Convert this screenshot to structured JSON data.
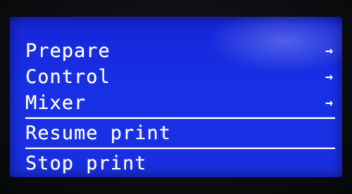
{
  "menu": {
    "items": [
      {
        "label": "Prepare",
        "arrow": "→"
      },
      {
        "label": "Control",
        "arrow": "→"
      },
      {
        "label": "Mixer",
        "arrow": "→"
      },
      {
        "label": "Resume print",
        "arrow": ""
      },
      {
        "label": "Stop print",
        "arrow": ""
      }
    ]
  },
  "colors": {
    "screen_blue": "#1730e6",
    "text": "#eef0ff",
    "bezel": "#0b0d12"
  },
  "icons": {
    "submenu": "arrow-right-icon"
  }
}
